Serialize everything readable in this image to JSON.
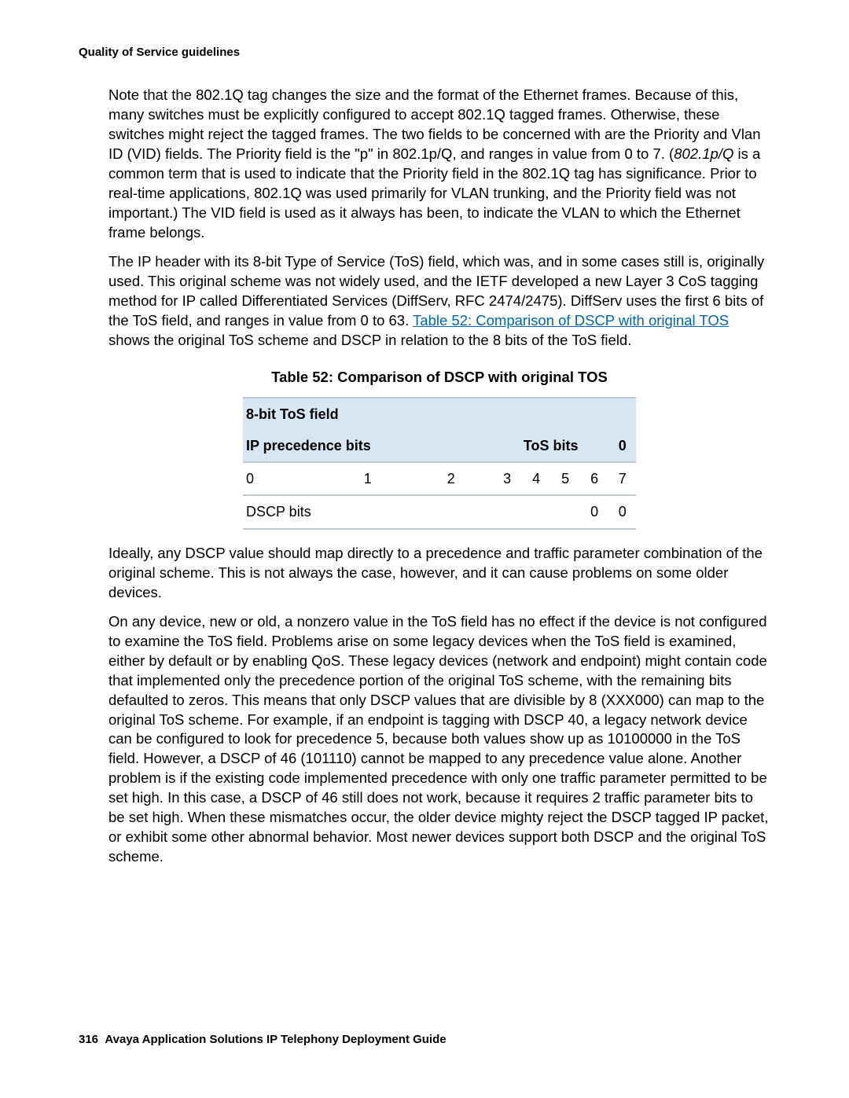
{
  "running_head": "Quality of Service guidelines",
  "para1_a": "Note that the 802.1Q tag changes the size and the format of the Ethernet frames. Because of this, many switches must be explicitly configured to accept 802.1Q tagged frames. Otherwise, these switches might reject the tagged frames. The two fields to be concerned with are the Priority and Vlan ID (VID) fields. The Priority field is the \"p\" in 802.1p/Q, and ranges in value from 0 to 7. (",
  "para1_i": "802.1p/Q",
  "para1_b": " is a common term that is used to indicate that the Priority field in the 802.1Q tag has significance. Prior to real-time applications, 802.1Q was used primarily for VLAN trunking, and the Priority field was not important.) The VID field is used as it always has been, to indicate the VLAN to which the Ethernet frame belongs.",
  "para2_a": "The IP header with its 8-bit Type of Service (ToS) field, which was, and in some cases still is, originally used. This original scheme was not widely used, and the IETF developed a new Layer 3 CoS tagging method for IP called Differentiated Services (DiffServ, RFC 2474/2475). DiffServ uses the first 6 bits of the ToS field, and ranges in value from 0 to 63. ",
  "para2_link": "Table 52:  Comparison of DSCP with original TOS",
  "para2_b": " shows the original ToS scheme and DSCP in relation to the 8 bits of the ToS field.",
  "table_caption": "Table 52: Comparison of DSCP with original TOS",
  "table": {
    "r1c1": "8-bit ToS field",
    "r2c1": "IP precedence bits",
    "r2c2": "ToS bits",
    "r2c3": "0",
    "b0": "0",
    "b1": "1",
    "b2": "2",
    "b3": "3",
    "b4": "4",
    "b5": "5",
    "b6": "6",
    "b7": "7",
    "r4c1": "DSCP bits",
    "r4c2": "0",
    "r4c3": "0"
  },
  "para3": "Ideally, any DSCP value should map directly to a precedence and traffic parameter combination of the original scheme. This is not always the case, however, and it can cause problems on some older devices.",
  "para4": "On any device, new or old, a nonzero value in the ToS field has no effect if the device is not configured to examine the ToS field. Problems arise on some legacy devices when the ToS field is examined, either by default or by enabling QoS. These legacy devices (network and endpoint) might contain code that implemented only the precedence portion of the original ToS scheme, with the remaining bits defaulted to zeros. This means that only DSCP values that are divisible by 8 (XXX000) can map to the original ToS scheme. For example, if an endpoint is tagging with DSCP 40, a legacy network device can be configured to look for precedence 5, because both values show up as 10100000 in the ToS field. However, a DSCP of 46 (101110) cannot be mapped to any precedence value alone. Another problem is if the existing code implemented precedence with only one traffic parameter permitted to be set high. In this case, a DSCP of 46 still does not work, because it requires 2 traffic parameter bits to be set high. When these mismatches occur, the older device mighty reject the DSCP tagged IP packet, or exhibit some other abnormal behavior. Most newer devices support both DSCP and the original ToS scheme.",
  "footer_page": "316",
  "footer_title": "Avaya Application Solutions IP Telephony Deployment Guide"
}
